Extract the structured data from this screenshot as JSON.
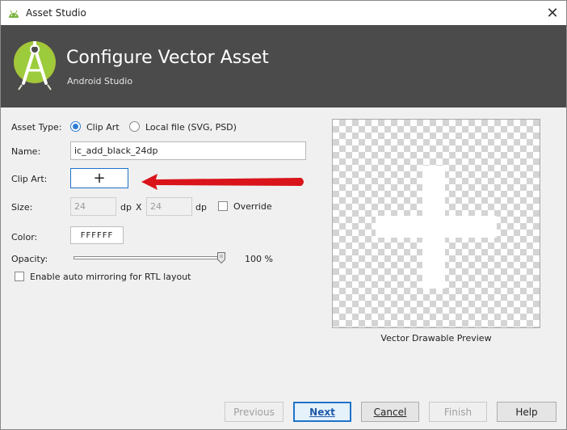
{
  "window": {
    "title": "Asset Studio",
    "close_glyph": "✕"
  },
  "header": {
    "title": "Configure Vector Asset",
    "subtitle": "Android Studio"
  },
  "form": {
    "asset_type_label": "Asset Type:",
    "asset_type_options": [
      {
        "label": "Clip Art",
        "selected": true
      },
      {
        "label": "Local file (SVG, PSD)",
        "selected": false
      }
    ],
    "name_label": "Name:",
    "name_value": "ic_add_black_24dp",
    "clip_art_label": "Clip Art:",
    "clip_art_glyph": "+",
    "size_label": "Size:",
    "size_width": "24",
    "size_height": "24",
    "size_unit_1": "dp",
    "size_x": "X",
    "size_unit_2": "dp",
    "override_label": "Override",
    "color_label": "Color:",
    "color_value": "FFFFFF",
    "opacity_label": "Opacity:",
    "opacity_value": 100,
    "opacity_text": "100 %",
    "rtl_label": "Enable auto mirroring for RTL layout"
  },
  "preview": {
    "label": "Vector Drawable Preview"
  },
  "footer": {
    "previous_label": "Previous",
    "next_label": "Next",
    "cancel_label": "Cancel",
    "finish_label": "Finish",
    "help_label": "Help"
  },
  "colors": {
    "header_bg": "#4b4b4b",
    "accent": "#1e73c9",
    "arrow": "#d9151b",
    "logo_green": "#a4c639"
  }
}
